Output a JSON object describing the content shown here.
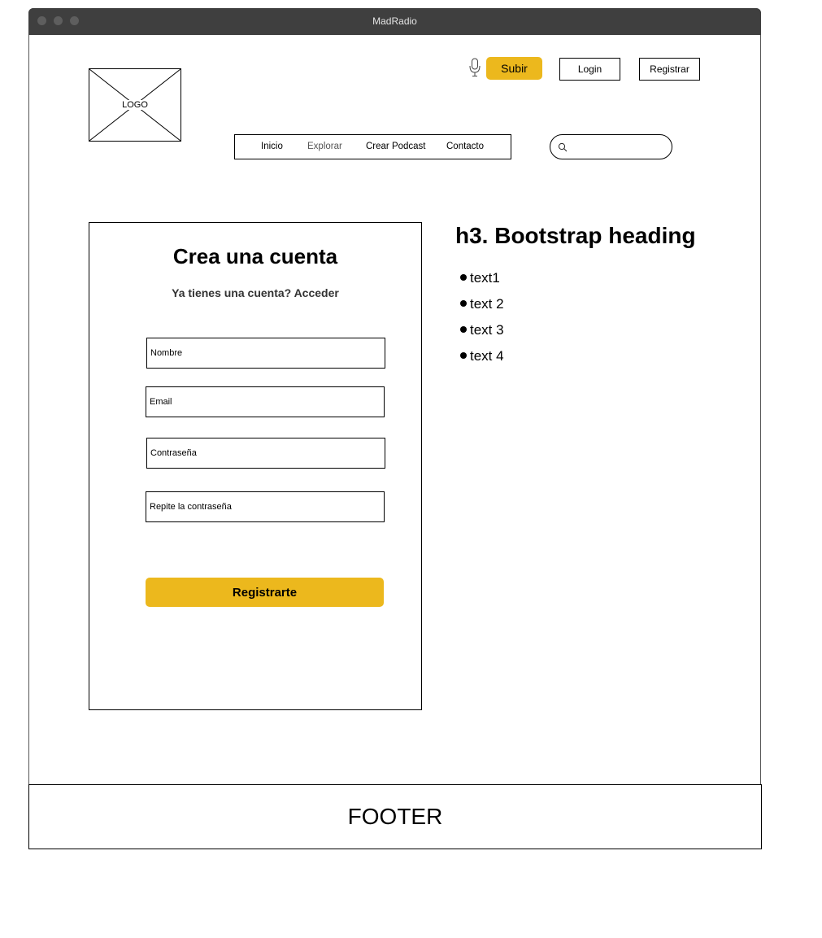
{
  "window": {
    "title": "MadRadio"
  },
  "logo": {
    "label": "LOGO"
  },
  "header": {
    "upload_label": "Subir",
    "login_label": "Login",
    "register_label": "Registrar",
    "accent_color": "#ecb81d"
  },
  "nav": {
    "items": [
      {
        "label": "Inicio"
      },
      {
        "label": "Explorar"
      },
      {
        "label": "Crear Podcast"
      },
      {
        "label": "Contacto"
      }
    ]
  },
  "search": {
    "value": ""
  },
  "signup": {
    "title": "Crea una cuenta",
    "subtitle": "Ya tienes una cuenta? Acceder",
    "fields": [
      {
        "placeholder": "Nombre"
      },
      {
        "placeholder": "Email"
      },
      {
        "placeholder": "Contraseña"
      },
      {
        "placeholder": "Repite la contraseña"
      }
    ],
    "submit_label": "Registrarte"
  },
  "info": {
    "heading": "h3. Bootstrap heading",
    "items": [
      "text1",
      "text 2",
      "text 3",
      "text 4"
    ]
  },
  "footer": {
    "label": "FOOTER"
  }
}
